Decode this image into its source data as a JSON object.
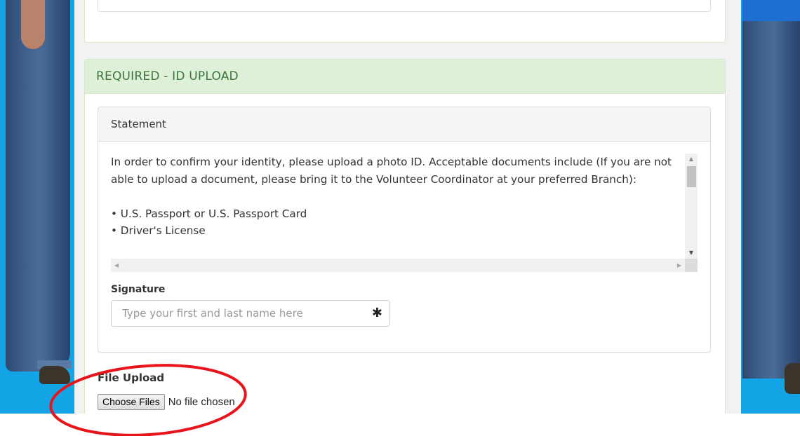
{
  "id_section": {
    "heading": "REQUIRED - ID UPLOAD",
    "colors": {
      "heading_bg": "#dff0d8",
      "heading_text": "#3c763d"
    }
  },
  "statement": {
    "heading": "Statement",
    "paragraph": "In order to confirm your identity, please upload a photo ID. Acceptable documents include (If you are not able to upload a document, please bring it to the Volunteer Coordinator at your preferred Branch):",
    "items": [
      "• U.S. Passport or U.S. Passport Card",
      "• Driver's License"
    ]
  },
  "signature": {
    "label": "Signature",
    "placeholder": "Type your first and last name here",
    "value": "",
    "required_icon": "asterisk-icon"
  },
  "file_upload": {
    "label": "File Upload",
    "button_label": "Choose Files",
    "status": "No file chosen"
  },
  "annotation": {
    "shape": "ellipse",
    "color": "#e8141b"
  },
  "background": {
    "color": "#13a4e6"
  }
}
